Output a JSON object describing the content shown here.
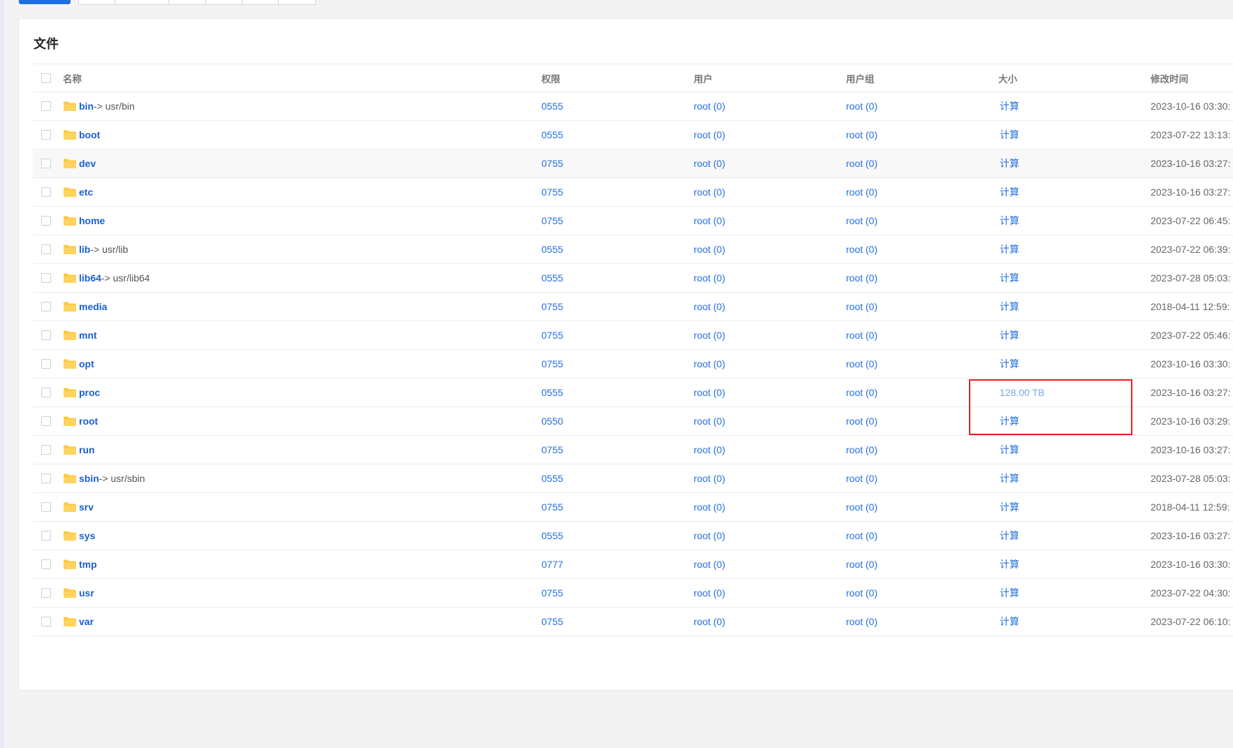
{
  "tabs": {
    "active_count": 1,
    "inactive_count": 6
  },
  "card": {
    "title": "文件"
  },
  "table": {
    "headers": {
      "name": "名称",
      "perm": "权限",
      "user": "用户",
      "group": "用户组",
      "size": "大小",
      "mtime": "修改时间"
    },
    "rows": [
      {
        "name": "bin",
        "target": "-> usr/bin",
        "perm": "0555",
        "user": "root (0)",
        "group": "root (0)",
        "size": "计算",
        "mtime": "2023-10-16 03:30:"
      },
      {
        "name": "boot",
        "target": "",
        "perm": "0555",
        "user": "root (0)",
        "group": "root (0)",
        "size": "计算",
        "mtime": "2023-07-22 13:13:"
      },
      {
        "name": "dev",
        "target": "",
        "perm": "0755",
        "user": "root (0)",
        "group": "root (0)",
        "size": "计算",
        "mtime": "2023-10-16 03:27:"
      },
      {
        "name": "etc",
        "target": "",
        "perm": "0755",
        "user": "root (0)",
        "group": "root (0)",
        "size": "计算",
        "mtime": "2023-10-16 03:27:"
      },
      {
        "name": "home",
        "target": "",
        "perm": "0755",
        "user": "root (0)",
        "group": "root (0)",
        "size": "计算",
        "mtime": "2023-07-22 06:45:"
      },
      {
        "name": "lib",
        "target": "-> usr/lib",
        "perm": "0555",
        "user": "root (0)",
        "group": "root (0)",
        "size": "计算",
        "mtime": "2023-07-22 06:39:"
      },
      {
        "name": "lib64",
        "target": "-> usr/lib64",
        "perm": "0555",
        "user": "root (0)",
        "group": "root (0)",
        "size": "计算",
        "mtime": "2023-07-28 05:03:"
      },
      {
        "name": "media",
        "target": "",
        "perm": "0755",
        "user": "root (0)",
        "group": "root (0)",
        "size": "计算",
        "mtime": "2018-04-11 12:59:"
      },
      {
        "name": "mnt",
        "target": "",
        "perm": "0755",
        "user": "root (0)",
        "group": "root (0)",
        "size": "计算",
        "mtime": "2023-07-22 05:46:"
      },
      {
        "name": "opt",
        "target": "",
        "perm": "0755",
        "user": "root (0)",
        "group": "root (0)",
        "size": "计算",
        "mtime": "2023-10-16 03:30:"
      },
      {
        "name": "proc",
        "target": "",
        "perm": "0555",
        "user": "root (0)",
        "group": "root (0)",
        "size": "128.00 TB",
        "mtime": "2023-10-16 03:27:"
      },
      {
        "name": "root",
        "target": "",
        "perm": "0550",
        "user": "root (0)",
        "group": "root (0)",
        "size": "计算",
        "mtime": "2023-10-16 03:29:"
      },
      {
        "name": "run",
        "target": "",
        "perm": "0755",
        "user": "root (0)",
        "group": "root (0)",
        "size": "计算",
        "mtime": "2023-10-16 03:27:"
      },
      {
        "name": "sbin",
        "target": "-> usr/sbin",
        "perm": "0555",
        "user": "root (0)",
        "group": "root (0)",
        "size": "计算",
        "mtime": "2023-07-28 05:03:"
      },
      {
        "name": "srv",
        "target": "",
        "perm": "0755",
        "user": "root (0)",
        "group": "root (0)",
        "size": "计算",
        "mtime": "2018-04-11 12:59:"
      },
      {
        "name": "sys",
        "target": "",
        "perm": "0555",
        "user": "root (0)",
        "group": "root (0)",
        "size": "计算",
        "mtime": "2023-10-16 03:27:"
      },
      {
        "name": "tmp",
        "target": "",
        "perm": "0777",
        "user": "root (0)",
        "group": "root (0)",
        "size": "计算",
        "mtime": "2023-10-16 03:30:"
      },
      {
        "name": "usr",
        "target": "",
        "perm": "0755",
        "user": "root (0)",
        "group": "root (0)",
        "size": "计算",
        "mtime": "2023-07-22 04:30:"
      },
      {
        "name": "var",
        "target": "",
        "perm": "0755",
        "user": "root (0)",
        "group": "root (0)",
        "size": "计算",
        "mtime": "2023-07-22 06:10:"
      }
    ]
  },
  "colors": {
    "link": "#2370e0",
    "folder": "#ffc83d",
    "highlight": "#e02020",
    "accent": "#1e6fe0"
  },
  "icons": {
    "folder": "folder-icon",
    "checkbox": "checkbox"
  }
}
